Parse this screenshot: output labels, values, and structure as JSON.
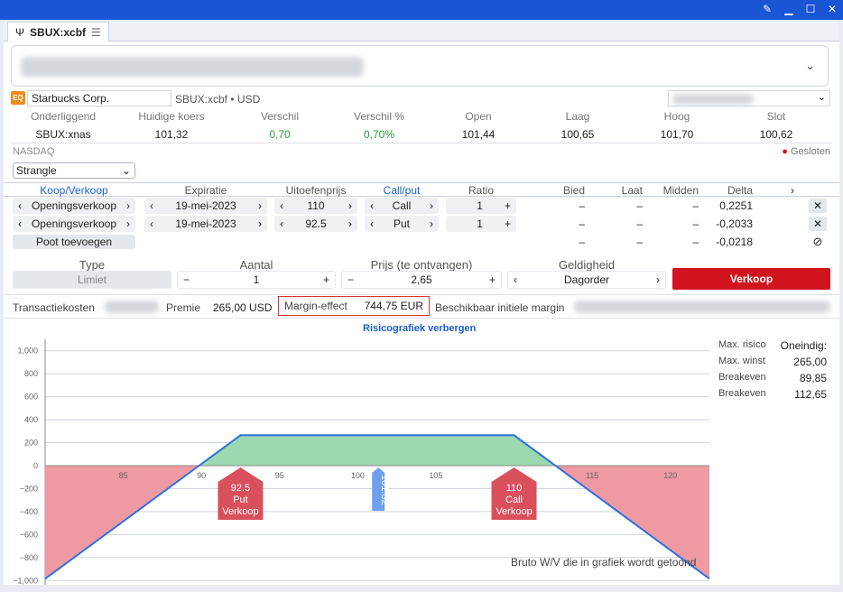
{
  "window": {
    "tab_label": "SBUX:xcbf"
  },
  "instrument": {
    "name": "Starbucks Corp.",
    "symbol": "SBUX:xcbf",
    "currency": "USD",
    "exchange_badge": "EQ"
  },
  "quote_headers": [
    "Onderliggend",
    "Huidige koers",
    "Verschil",
    "Verschil %",
    "Open",
    "Laag",
    "Hoog",
    "Slot"
  ],
  "quote_values": [
    "SBUX:xnas",
    "101,32",
    "0,70",
    "0,70%",
    "101,44",
    "100,65",
    "101,70",
    "100,62"
  ],
  "market": {
    "exchange": "NASDAQ",
    "status": "Gesloten"
  },
  "strategy": {
    "selected": "Strangle"
  },
  "legs_headers": [
    "Koop/Verkoop",
    "Expiratie",
    "Uitoefenprijs",
    "Call/put",
    "Ratio",
    "Bied",
    "Laat",
    "Midden",
    "Delta"
  ],
  "legs": [
    {
      "side": "Openingsverkoop",
      "expiry": "19-mei-2023",
      "strike": "110",
      "type": "Call",
      "ratio": "1",
      "bid": "–",
      "ask": "–",
      "mid": "–",
      "delta": "0,2251"
    },
    {
      "side": "Openingsverkoop",
      "expiry": "19-mei-2023",
      "strike": "92.5",
      "type": "Put",
      "ratio": "1",
      "bid": "–",
      "ask": "–",
      "mid": "–",
      "delta": "-0,2033"
    }
  ],
  "totals": {
    "add_leg": "Poot toevoegen",
    "bid": "–",
    "ask": "–",
    "mid": "–",
    "delta": "-0,0218"
  },
  "order": {
    "type_label": "Type",
    "type_value": "Limiet",
    "qty_label": "Aantal",
    "qty_value": "1",
    "price_label": "Prijs (te ontvangen)",
    "price_value": "2,65",
    "validity_label": "Geldigheid",
    "validity_value": "Dagorder",
    "submit": "Verkoop"
  },
  "costs": {
    "transaction_label": "Transactiekosten",
    "premium_label": "Premie",
    "premium_value": "265,00 USD",
    "margin_label": "Margin-effect",
    "margin_value": "744,75 EUR",
    "available_label": "Beschikbaar initiele margin"
  },
  "chart_toggle": "Risicografiek verbergen",
  "stats": [
    {
      "label": "Max. risico",
      "value": "Oneindig:"
    },
    {
      "label": "Max. winst",
      "value": "265,00"
    },
    {
      "label": "Breakeven",
      "value": "89,85"
    },
    {
      "label": "Breakeven",
      "value": "112,65"
    }
  ],
  "chart_note": "Bruto W/V die in grafiek wordt getoond",
  "colors": {
    "accent": "#1a55d6",
    "sell": "#d1141e",
    "profit": "#9bd9ae",
    "loss": "#ef9aa2",
    "payoff_line": "#2f6fe0",
    "marker_red": "#d9505d",
    "marker_blue": "#6f9ff0",
    "positive": "#2a9a3a"
  },
  "chart_data": {
    "type": "line",
    "x": [
      80,
      89.85,
      92.5,
      110,
      112.65,
      122.5
    ],
    "y": [
      -985,
      0,
      265,
      265,
      0,
      -985
    ],
    "xticks": [
      85,
      90,
      95,
      100,
      105,
      115,
      120
    ],
    "yticks": [
      1000,
      800,
      600,
      400,
      200,
      0,
      -200,
      -400,
      -600,
      -800,
      -1000
    ],
    "ytick_labels": [
      "1,000",
      "800",
      "600",
      "400",
      "200",
      "0",
      "−200",
      "−400",
      "−600",
      "−800",
      "−1,000"
    ],
    "xlim": [
      80,
      122.5
    ],
    "ylim": [
      -1100,
      1100
    ],
    "markers": [
      {
        "x": 92.5,
        "lines": [
          "92.5",
          "Put",
          "Verkoop"
        ],
        "color": "red"
      },
      {
        "x": 101.32,
        "lines": [
          "101.32"
        ],
        "color": "blue"
      },
      {
        "x": 110,
        "lines": [
          "110",
          "Call",
          "Verkoop"
        ],
        "color": "red"
      }
    ]
  }
}
